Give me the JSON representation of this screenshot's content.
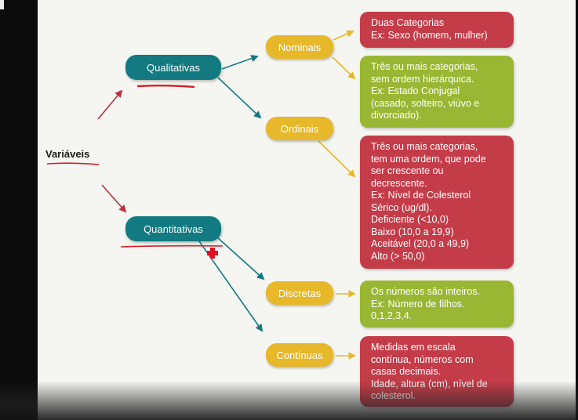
{
  "root": {
    "label": "Variáveis"
  },
  "categories": {
    "qualitativas": "Qualitativas",
    "quantitativas": "Quantitativas"
  },
  "subtypes": {
    "nominais": "Nominais",
    "ordinais": "Ordinais",
    "discretas": "Discretas",
    "continuas": "Contínuas"
  },
  "descriptions": {
    "nominais_duas": "Duas Categorias\nEx: Sexo (homem, mulher)",
    "nominais_tres": "Três ou mais categorias,\nsem ordem hierárquica.\nEx: Estado Conjugal\n(casado, solteiro, viúvo e\ndivorciado).",
    "ordinais": "Três ou mais categorias,\ntem uma ordem, que pode\nser crescente ou\ndecrescente.\nEx: Nível de Colesterol\nSérico (ug/dl).\nDeficiente (<10,0)\nBaixo (10,0 a 19,9)\nAceitável (20,0 a 49,9)\nAlto (> 50,0)",
    "discretas": "Os números são inteiros.\nEx: Número de filhos.\n0,1,2,3,4.",
    "continuas": "Medidas em escala\ncontínua, números com\ncasas decimais.\nIdade, altura (cm), nível de\ncolesterol."
  },
  "colors": {
    "teal": "#127a80",
    "yellow": "#e6b82a",
    "red": "#c43c48",
    "green": "#9ab734",
    "arrow_red": "#b8323e",
    "underline": "#d81e28"
  }
}
